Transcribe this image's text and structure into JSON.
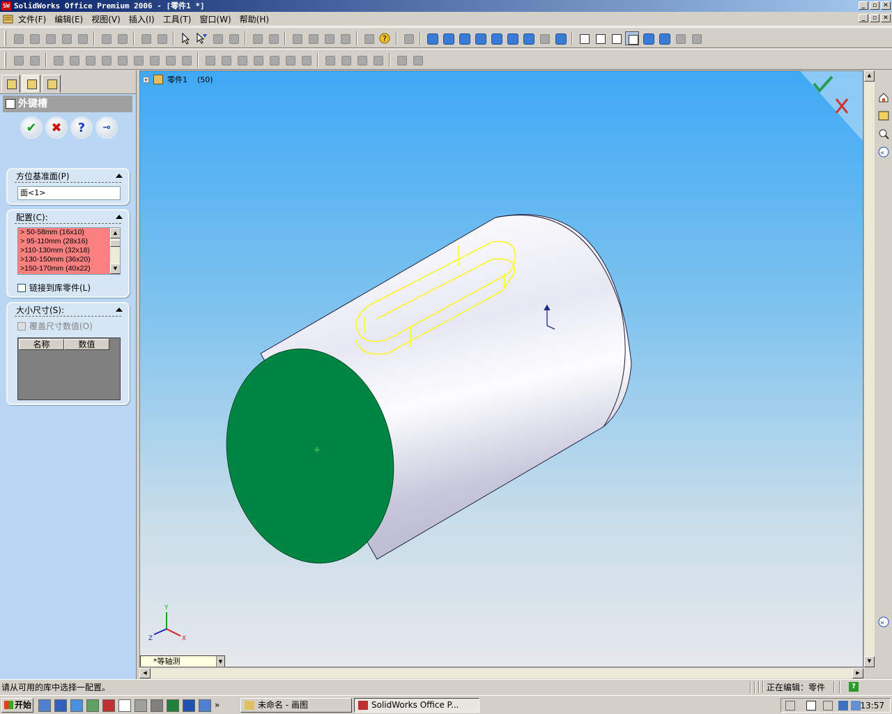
{
  "window": {
    "title": "SolidWorks Office Premium 2006 - [零件1 *]",
    "minimize": "_",
    "maximize": "▫",
    "close": "✕"
  },
  "menu": {
    "items": [
      "文件(F)",
      "编辑(E)",
      "视图(V)",
      "插入(I)",
      "工具(T)",
      "窗口(W)",
      "帮助(H)"
    ]
  },
  "property_manager": {
    "title": "外键槽",
    "orientation_group": {
      "title": "方位基准面(P)",
      "face_value": "面<1>"
    },
    "config_group": {
      "title": "配置(C):",
      "items": [
        "> 50-58mm (16x10)",
        "> 95-110mm  (28x16)",
        ">110-130mm  (32x18)",
        ">130-150mm  (36x20)",
        ">150-170mm  (40x22)"
      ],
      "link_label": "链接到库零件(L)"
    },
    "size_group": {
      "title": "大小尺寸(S):",
      "override_label": "覆盖尺寸数值(O)",
      "col_name": "名称",
      "col_value": "数值"
    }
  },
  "viewport": {
    "tree_part": "零件1",
    "tree_count": "(50)",
    "view_orientation": "*等轴测"
  },
  "status": {
    "left": "请从可用的库中选择一配置。",
    "right": "正在编辑：零件"
  },
  "taskbar": {
    "start_label": "开始",
    "tasks": [
      "未命名 - 画图",
      "SolidWorks Office P..."
    ],
    "clock": "13:57",
    "more": "»"
  },
  "colors": {
    "cylinder_end_face": "#008542",
    "keyway_outline": "#ffff00",
    "config_list_bg": "#fc8080",
    "viewport_top": "#3fa9f5"
  }
}
